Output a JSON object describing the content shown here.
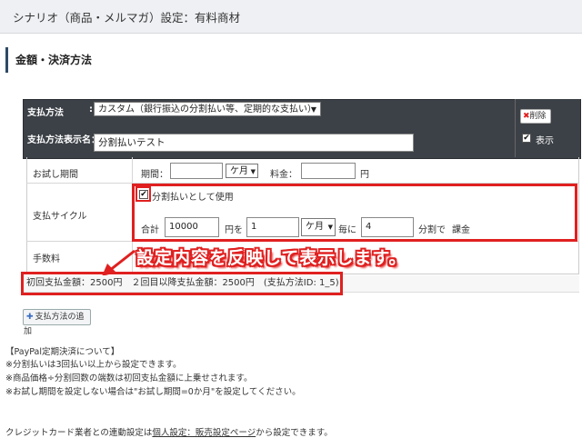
{
  "header": {
    "title": "シナリオ（商品・メルマガ）設定：有料商材"
  },
  "section": {
    "title": "金額・決済方法"
  },
  "payment": {
    "method_label": "支払方法",
    "method_colon": ":",
    "method_value": "カスタム（銀行振込の分割払い等、定期的な支払い）",
    "display_name_label": "支払方法表示名：",
    "display_name_value": "分割払いテスト",
    "delete_label": "削除",
    "show_label": "表示"
  },
  "trial": {
    "label": "お試し期間",
    "period_label": "期間：",
    "unit_value": "ケ月",
    "fee_label": "料金：",
    "fee_unit": "円"
  },
  "cycle": {
    "label": "支払サイクル",
    "use_label": "分割払いとして使用",
    "total_label": "合計",
    "total_value": "10000",
    "yen_wo": "円を",
    "interval_value": "1",
    "interval_unit": "ケ月",
    "every_label": "毎に",
    "count_value": "4",
    "split_label": "分割で",
    "charge_label": "課金"
  },
  "fee": {
    "label": "手数料"
  },
  "callout": {
    "text": "設定内容を反映して表示します。"
  },
  "summary": {
    "text": "初回支払金額：2500円　２回目以降支払金額：2500円　(支払方法ID: 1_5)"
  },
  "add_button": {
    "label": "支払方法の追加"
  },
  "notes": {
    "heading": "【PayPal定期決済について】",
    "lines": [
      "※分割払いは3回払い以上から設定できます。",
      "※商品価格÷分割回数の端数は初回支払金額に上乗せされます。",
      "※お試し期間を設定しない場合は\"お試し期間=0か月\"を設定してください。"
    ]
  },
  "footer": {
    "prefix": "クレジットカード業者との連動設定は",
    "link": "個人設定：販売設定ページ",
    "suffix": "から設定できます。"
  },
  "colors": {
    "accent_red": "#e02020",
    "panel_dark": "#3c4147"
  }
}
